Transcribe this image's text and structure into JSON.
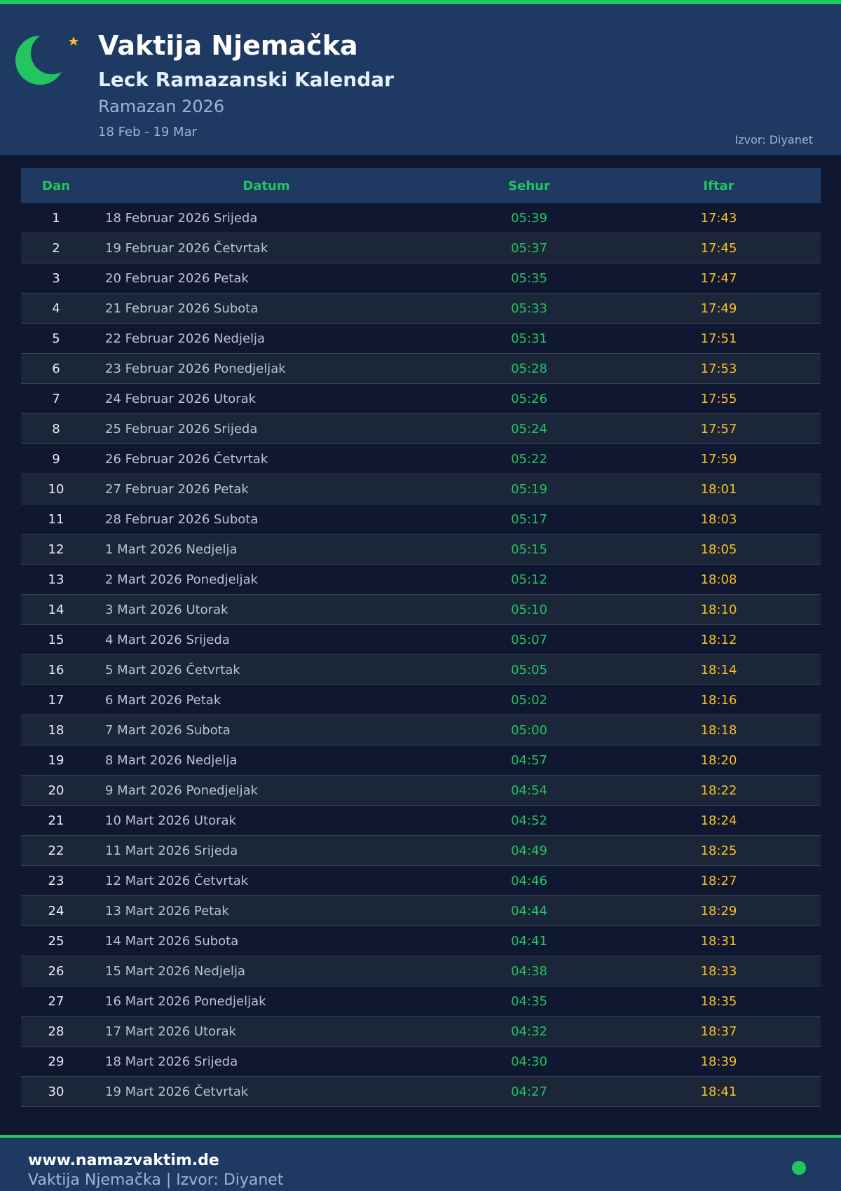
{
  "header": {
    "title": "Vaktija Njemačka",
    "subtitle": "Leck Ramazanski Kalendar",
    "year": "Ramazan 2026",
    "range": "18 Feb - 19 Mar",
    "source": "Izvor: Diyanet",
    "logo_icon": "crescent-star-icon"
  },
  "table": {
    "headers": {
      "dan": "Dan",
      "datum": "Datum",
      "sehur": "Sehur",
      "iftar": "Iftar"
    },
    "rows": [
      {
        "dan": "1",
        "datum": "18 Februar 2026 Srijeda",
        "sehur": "05:39",
        "iftar": "17:43"
      },
      {
        "dan": "2",
        "datum": "19 Februar 2026 Četvrtak",
        "sehur": "05:37",
        "iftar": "17:45"
      },
      {
        "dan": "3",
        "datum": "20 Februar 2026 Petak",
        "sehur": "05:35",
        "iftar": "17:47"
      },
      {
        "dan": "4",
        "datum": "21 Februar 2026 Subota",
        "sehur": "05:33",
        "iftar": "17:49"
      },
      {
        "dan": "5",
        "datum": "22 Februar 2026 Nedjelja",
        "sehur": "05:31",
        "iftar": "17:51"
      },
      {
        "dan": "6",
        "datum": "23 Februar 2026 Ponedjeljak",
        "sehur": "05:28",
        "iftar": "17:53"
      },
      {
        "dan": "7",
        "datum": "24 Februar 2026 Utorak",
        "sehur": "05:26",
        "iftar": "17:55"
      },
      {
        "dan": "8",
        "datum": "25 Februar 2026 Srijeda",
        "sehur": "05:24",
        "iftar": "17:57"
      },
      {
        "dan": "9",
        "datum": "26 Februar 2026 Četvrtak",
        "sehur": "05:22",
        "iftar": "17:59"
      },
      {
        "dan": "10",
        "datum": "27 Februar 2026 Petak",
        "sehur": "05:19",
        "iftar": "18:01"
      },
      {
        "dan": "11",
        "datum": "28 Februar 2026 Subota",
        "sehur": "05:17",
        "iftar": "18:03"
      },
      {
        "dan": "12",
        "datum": "1 Mart 2026 Nedjelja",
        "sehur": "05:15",
        "iftar": "18:05"
      },
      {
        "dan": "13",
        "datum": "2 Mart 2026 Ponedjeljak",
        "sehur": "05:12",
        "iftar": "18:08"
      },
      {
        "dan": "14",
        "datum": "3 Mart 2026 Utorak",
        "sehur": "05:10",
        "iftar": "18:10"
      },
      {
        "dan": "15",
        "datum": "4 Mart 2026 Srijeda",
        "sehur": "05:07",
        "iftar": "18:12"
      },
      {
        "dan": "16",
        "datum": "5 Mart 2026 Četvrtak",
        "sehur": "05:05",
        "iftar": "18:14"
      },
      {
        "dan": "17",
        "datum": "6 Mart 2026 Petak",
        "sehur": "05:02",
        "iftar": "18:16"
      },
      {
        "dan": "18",
        "datum": "7 Mart 2026 Subota",
        "sehur": "05:00",
        "iftar": "18:18"
      },
      {
        "dan": "19",
        "datum": "8 Mart 2026 Nedjelja",
        "sehur": "04:57",
        "iftar": "18:20"
      },
      {
        "dan": "20",
        "datum": "9 Mart 2026 Ponedjeljak",
        "sehur": "04:54",
        "iftar": "18:22"
      },
      {
        "dan": "21",
        "datum": "10 Mart 2026 Utorak",
        "sehur": "04:52",
        "iftar": "18:24"
      },
      {
        "dan": "22",
        "datum": "11 Mart 2026 Srijeda",
        "sehur": "04:49",
        "iftar": "18:25"
      },
      {
        "dan": "23",
        "datum": "12 Mart 2026 Četvrtak",
        "sehur": "04:46",
        "iftar": "18:27"
      },
      {
        "dan": "24",
        "datum": "13 Mart 2026 Petak",
        "sehur": "04:44",
        "iftar": "18:29"
      },
      {
        "dan": "25",
        "datum": "14 Mart 2026 Subota",
        "sehur": "04:41",
        "iftar": "18:31"
      },
      {
        "dan": "26",
        "datum": "15 Mart 2026 Nedjelja",
        "sehur": "04:38",
        "iftar": "18:33"
      },
      {
        "dan": "27",
        "datum": "16 Mart 2026 Ponedjeljak",
        "sehur": "04:35",
        "iftar": "18:35"
      },
      {
        "dan": "28",
        "datum": "17 Mart 2026 Utorak",
        "sehur": "04:32",
        "iftar": "18:37"
      },
      {
        "dan": "29",
        "datum": "18 Mart 2026 Srijeda",
        "sehur": "04:30",
        "iftar": "18:39"
      },
      {
        "dan": "30",
        "datum": "19 Mart 2026 Četvrtak",
        "sehur": "04:27",
        "iftar": "18:41"
      }
    ]
  },
  "footer": {
    "site": "www.namazvaktim.de",
    "note": "Vaktija Njemačka | Izvor: Diyanet",
    "status_icon": "status-dot-icon"
  },
  "colors": {
    "accent_green": "#22c55e",
    "iftar_yellow": "#fbbf24",
    "header_bg": "#1e3a63",
    "page_bg": "#0f1830"
  }
}
